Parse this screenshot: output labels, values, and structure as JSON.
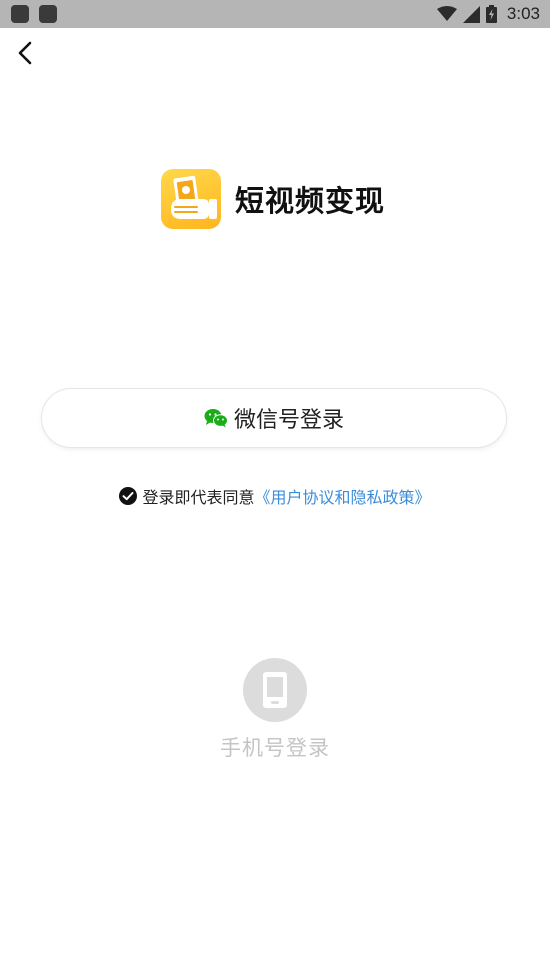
{
  "status_bar": {
    "time": "3:03",
    "icons": [
      "notification-icon",
      "notification-icon",
      "wifi-icon",
      "signal-icon",
      "battery-icon"
    ]
  },
  "navigation": {
    "back_icon": "chevron-left-icon"
  },
  "brand": {
    "app_name": "短视频变现",
    "logo_icon": "hand-money-icon"
  },
  "wechat_login": {
    "label": "微信号登录",
    "icon": "wechat-icon",
    "icon_color": "#1aad19"
  },
  "agreement": {
    "text": "登录即代表同意",
    "link": "《用户协议和隐私政策》",
    "link_color": "#3b8ddb",
    "checked": true
  },
  "phone_login": {
    "label": "手机号登录",
    "icon": "phone-icon"
  }
}
